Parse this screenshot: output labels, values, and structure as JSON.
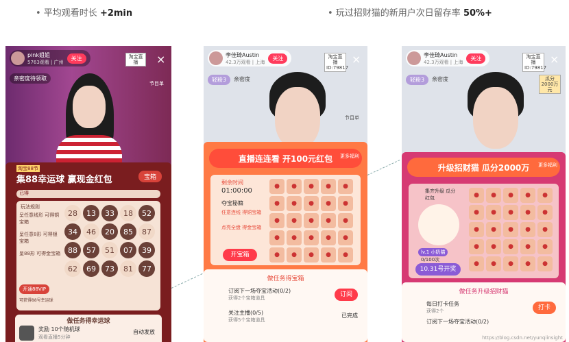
{
  "captions": {
    "left_prefix": "• 平均观看时长 ",
    "left_value": "+2min",
    "right_prefix": "• 玩过招财猫的新用户次日留存率 ",
    "right_value": "50%+"
  },
  "p1": {
    "anchor": "pink姐姐",
    "meta": "5763观看 | 广州",
    "follow": "关注",
    "platform": "淘宝直播",
    "close": "×",
    "intimacy": "亲密度待领取",
    "schedule": "节目单",
    "badge": "淘宝88节",
    "title": "集88幸运球 赢现金红包",
    "chest": "宝箱",
    "progress": "已得",
    "rules": "玩法规则",
    "rule_items": [
      "呈任意线形 可得铜宝箱",
      "呈任意8形 可得银宝箱",
      "呈88形 可得金宝箱"
    ],
    "balls": [
      "28",
      "13",
      "33",
      "18",
      "52",
      "34",
      "46",
      "20",
      "85",
      "87",
      "88",
      "57",
      "51",
      "07",
      "39",
      "62",
      "69",
      "73",
      "81",
      "77"
    ],
    "vip_btn": "开通88VIP",
    "vip_note": "可获得88号幸运球",
    "task_header": "做任务得幸运球",
    "task_line1": "奖励 10个随机球",
    "task_line2": "观看直播5分钟",
    "task_status": "自动发放"
  },
  "p2": {
    "anchor": "李佳琦Austin",
    "meta": "42.3万观看 | 上海",
    "follow": "关注",
    "platform": "淘宝直播",
    "platform_id": "ID:79817",
    "close": "×",
    "likes": "轻粉3",
    "intimacy": "亲密度",
    "schedule": "节目单",
    "banner": "直播连连看 开100元红包",
    "more": "更多福利",
    "countdown_label": "剩余时间",
    "countdown": "01:00:00",
    "secret": "夺宝秘籍",
    "tips": [
      "任意连线 得铜宝箱",
      "点亮全盘 得金宝箱"
    ],
    "open_btn": "开宝箱",
    "task_header": "做任务得宝箱",
    "tasks": [
      {
        "title": "订阅下一场夺宝活动(0/2)",
        "sub": "获得2个宝箱道具",
        "action": "订阅"
      },
      {
        "title": "关注主播(0/5)",
        "sub": "获得5个宝箱道具",
        "action": "已完成"
      }
    ]
  },
  "p3": {
    "anchor": "李佳琦Austin",
    "meta": "42.3万观看 | 上海",
    "follow": "关注",
    "platform": "淘宝直播",
    "platform_id": "ID:79817",
    "close": "×",
    "likes": "轻粉3",
    "intimacy": "亲密度",
    "prize": "瓜分 2000万元",
    "banner": "升级招财猫 瓜分2000万",
    "more": "更多福利",
    "cat_title": "集齐升级 瓜分红包",
    "level": "lv.1 小奶猫",
    "exp": "0/100次",
    "open_date": "10.31号开奖",
    "task_header": "做任务升级招财猫",
    "tasks": [
      {
        "title": "每日打卡任务",
        "sub": "获得2个",
        "action": "打卡"
      },
      {
        "title": "订阅下一场夺宝活动(0/2)",
        "sub": "",
        "action": ""
      }
    ],
    "watermark": "https://blog.csdn.net/yunqiinsight"
  }
}
